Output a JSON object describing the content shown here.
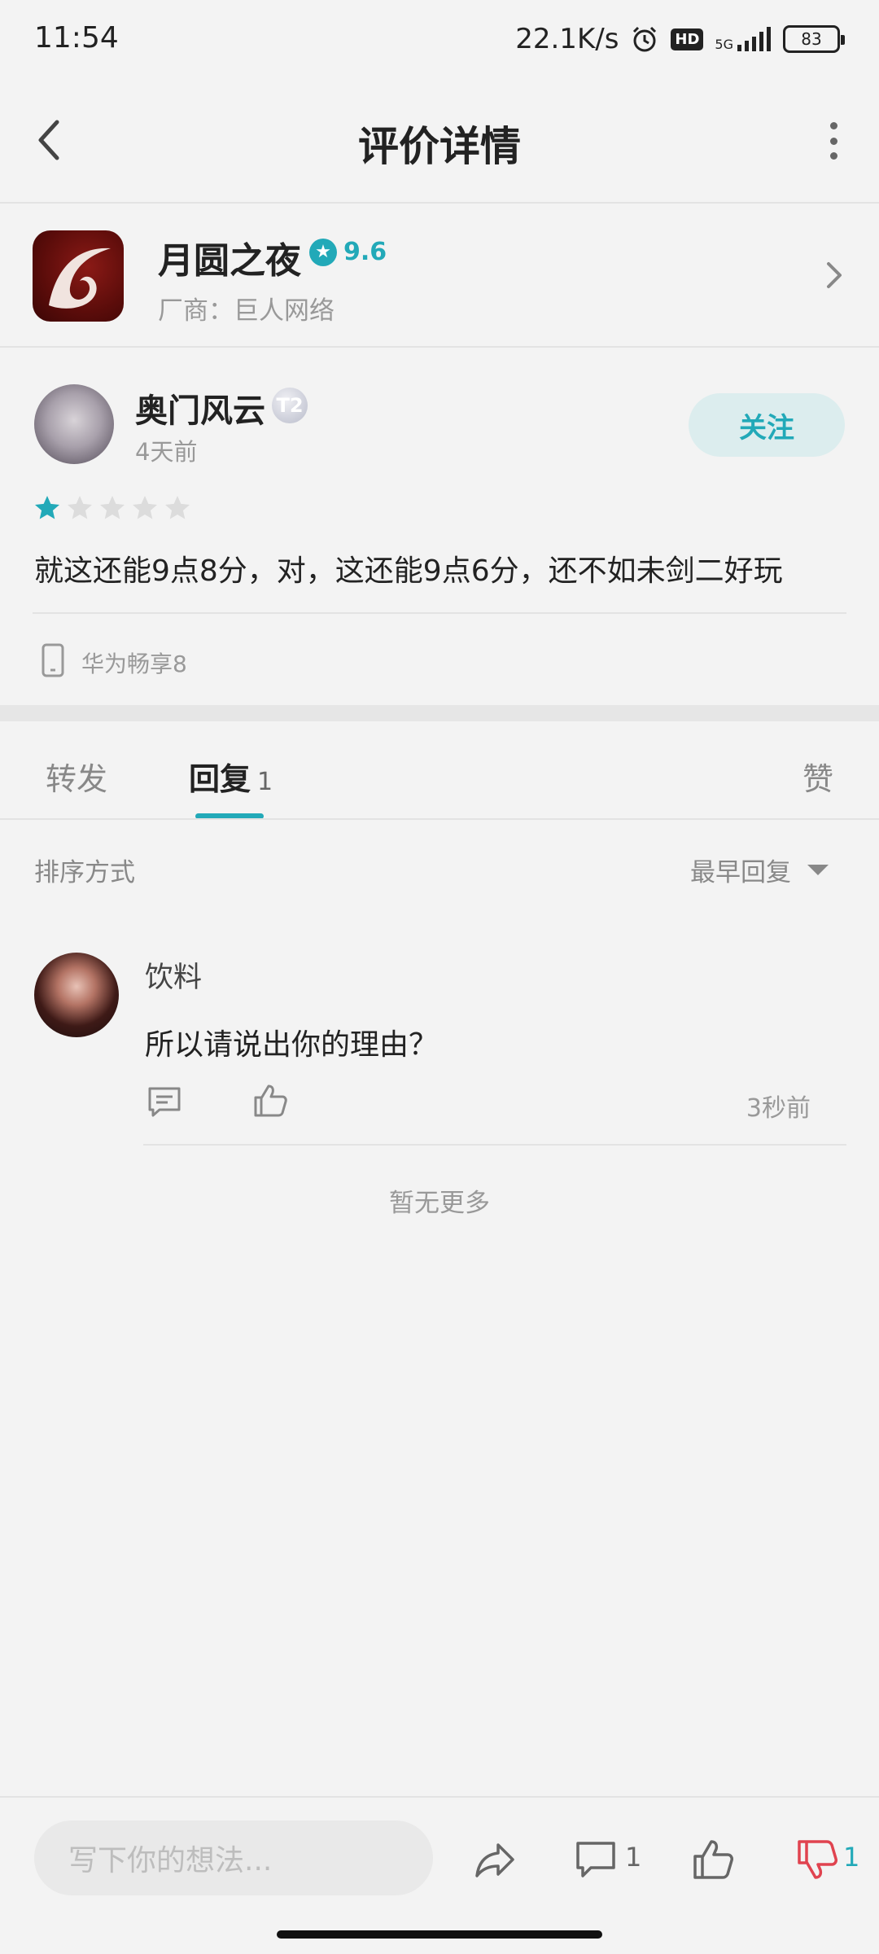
{
  "status_bar": {
    "time": "11:54",
    "network_speed": "22.1K/s",
    "hd": "HD",
    "network": "5G",
    "battery": "83"
  },
  "header": {
    "title": "评价详情"
  },
  "game": {
    "name": "月圆之夜",
    "rating": "9.6",
    "vendor": "厂商：巨人网络"
  },
  "review": {
    "author": "奥门风云",
    "level_badge": "T2",
    "time": "4天前",
    "follow_label": "关注",
    "stars_filled": 1,
    "stars_total": 5,
    "text": "就这还能9点8分，对，这还能9点6分，还不如未剑二好玩",
    "device": "华为畅享8"
  },
  "tabs": {
    "forward": "转发",
    "replies": "回复",
    "replies_count": "1",
    "likes": "赞"
  },
  "sort": {
    "label": "排序方式",
    "selected": "最早回复"
  },
  "replies": [
    {
      "user": "饮料",
      "text": "所以请说出你的理由？",
      "time": "3秒前"
    }
  ],
  "no_more": "暂无更多",
  "bottom_bar": {
    "input_placeholder": "写下你的想法...",
    "comment_count": "1",
    "dislike_count": "1"
  },
  "colors": {
    "accent": "#22a9b8",
    "dislike": "#e0434f",
    "background": "#f3f3f3"
  }
}
